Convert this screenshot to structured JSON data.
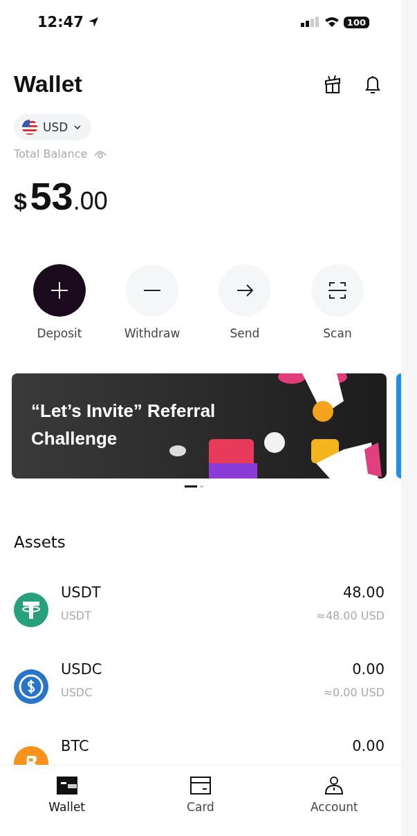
{
  "status_bar": {
    "time": "12:47",
    "battery": "100"
  },
  "header": {
    "title": "Wallet"
  },
  "currency": {
    "code": "USD"
  },
  "balance": {
    "label": "Total Balance",
    "symbol": "$",
    "whole": "53",
    "fraction": ".00"
  },
  "actions": [
    {
      "label": "Deposit",
      "kind": "plus",
      "primary": true
    },
    {
      "label": "Withdraw",
      "kind": "minus",
      "primary": false
    },
    {
      "label": "Send",
      "kind": "arrow",
      "primary": false
    },
    {
      "label": "Scan",
      "kind": "scan",
      "primary": false
    }
  ],
  "banner": {
    "title": "“Let’s Invite” Referral Challenge",
    "pages": [
      {
        "selected": true
      },
      {
        "selected": false
      }
    ]
  },
  "assets": {
    "title": "Assets",
    "items": [
      {
        "kind": "tether",
        "name": "USDT",
        "symbol": "USDT",
        "amount": "48.00",
        "value": "≈48.00 USD"
      },
      {
        "kind": "usdc",
        "name": "USDC",
        "symbol": "USDC",
        "amount": "0.00",
        "value": "≈0.00 USD"
      },
      {
        "kind": "btc",
        "name": "BTC",
        "amount": "0.00"
      }
    ]
  },
  "tab_bar": [
    {
      "label": "Wallet",
      "kind": "wallet",
      "selected": true
    },
    {
      "label": "Card",
      "kind": "card",
      "selected": false
    },
    {
      "label": "Account",
      "kind": "account",
      "selected": false
    }
  ]
}
